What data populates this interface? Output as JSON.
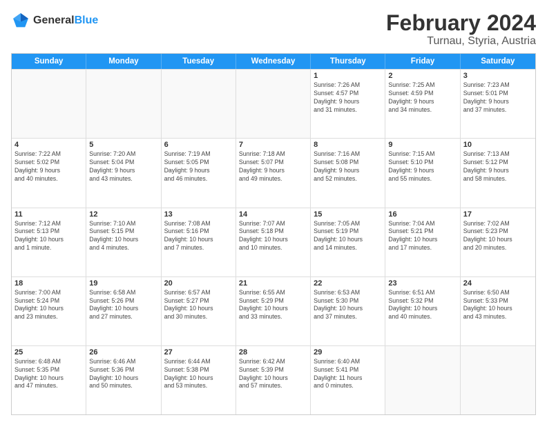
{
  "header": {
    "logo_general": "General",
    "logo_blue": "Blue",
    "title": "February 2024",
    "subtitle": "Turnau, Styria, Austria"
  },
  "weekdays": [
    "Sunday",
    "Monday",
    "Tuesday",
    "Wednesday",
    "Thursday",
    "Friday",
    "Saturday"
  ],
  "rows": [
    [
      {
        "day": "",
        "info": ""
      },
      {
        "day": "",
        "info": ""
      },
      {
        "day": "",
        "info": ""
      },
      {
        "day": "",
        "info": ""
      },
      {
        "day": "1",
        "info": "Sunrise: 7:26 AM\nSunset: 4:57 PM\nDaylight: 9 hours\nand 31 minutes."
      },
      {
        "day": "2",
        "info": "Sunrise: 7:25 AM\nSunset: 4:59 PM\nDaylight: 9 hours\nand 34 minutes."
      },
      {
        "day": "3",
        "info": "Sunrise: 7:23 AM\nSunset: 5:01 PM\nDaylight: 9 hours\nand 37 minutes."
      }
    ],
    [
      {
        "day": "4",
        "info": "Sunrise: 7:22 AM\nSunset: 5:02 PM\nDaylight: 9 hours\nand 40 minutes."
      },
      {
        "day": "5",
        "info": "Sunrise: 7:20 AM\nSunset: 5:04 PM\nDaylight: 9 hours\nand 43 minutes."
      },
      {
        "day": "6",
        "info": "Sunrise: 7:19 AM\nSunset: 5:05 PM\nDaylight: 9 hours\nand 46 minutes."
      },
      {
        "day": "7",
        "info": "Sunrise: 7:18 AM\nSunset: 5:07 PM\nDaylight: 9 hours\nand 49 minutes."
      },
      {
        "day": "8",
        "info": "Sunrise: 7:16 AM\nSunset: 5:08 PM\nDaylight: 9 hours\nand 52 minutes."
      },
      {
        "day": "9",
        "info": "Sunrise: 7:15 AM\nSunset: 5:10 PM\nDaylight: 9 hours\nand 55 minutes."
      },
      {
        "day": "10",
        "info": "Sunrise: 7:13 AM\nSunset: 5:12 PM\nDaylight: 9 hours\nand 58 minutes."
      }
    ],
    [
      {
        "day": "11",
        "info": "Sunrise: 7:12 AM\nSunset: 5:13 PM\nDaylight: 10 hours\nand 1 minute."
      },
      {
        "day": "12",
        "info": "Sunrise: 7:10 AM\nSunset: 5:15 PM\nDaylight: 10 hours\nand 4 minutes."
      },
      {
        "day": "13",
        "info": "Sunrise: 7:08 AM\nSunset: 5:16 PM\nDaylight: 10 hours\nand 7 minutes."
      },
      {
        "day": "14",
        "info": "Sunrise: 7:07 AM\nSunset: 5:18 PM\nDaylight: 10 hours\nand 10 minutes."
      },
      {
        "day": "15",
        "info": "Sunrise: 7:05 AM\nSunset: 5:19 PM\nDaylight: 10 hours\nand 14 minutes."
      },
      {
        "day": "16",
        "info": "Sunrise: 7:04 AM\nSunset: 5:21 PM\nDaylight: 10 hours\nand 17 minutes."
      },
      {
        "day": "17",
        "info": "Sunrise: 7:02 AM\nSunset: 5:23 PM\nDaylight: 10 hours\nand 20 minutes."
      }
    ],
    [
      {
        "day": "18",
        "info": "Sunrise: 7:00 AM\nSunset: 5:24 PM\nDaylight: 10 hours\nand 23 minutes."
      },
      {
        "day": "19",
        "info": "Sunrise: 6:58 AM\nSunset: 5:26 PM\nDaylight: 10 hours\nand 27 minutes."
      },
      {
        "day": "20",
        "info": "Sunrise: 6:57 AM\nSunset: 5:27 PM\nDaylight: 10 hours\nand 30 minutes."
      },
      {
        "day": "21",
        "info": "Sunrise: 6:55 AM\nSunset: 5:29 PM\nDaylight: 10 hours\nand 33 minutes."
      },
      {
        "day": "22",
        "info": "Sunrise: 6:53 AM\nSunset: 5:30 PM\nDaylight: 10 hours\nand 37 minutes."
      },
      {
        "day": "23",
        "info": "Sunrise: 6:51 AM\nSunset: 5:32 PM\nDaylight: 10 hours\nand 40 minutes."
      },
      {
        "day": "24",
        "info": "Sunrise: 6:50 AM\nSunset: 5:33 PM\nDaylight: 10 hours\nand 43 minutes."
      }
    ],
    [
      {
        "day": "25",
        "info": "Sunrise: 6:48 AM\nSunset: 5:35 PM\nDaylight: 10 hours\nand 47 minutes."
      },
      {
        "day": "26",
        "info": "Sunrise: 6:46 AM\nSunset: 5:36 PM\nDaylight: 10 hours\nand 50 minutes."
      },
      {
        "day": "27",
        "info": "Sunrise: 6:44 AM\nSunset: 5:38 PM\nDaylight: 10 hours\nand 53 minutes."
      },
      {
        "day": "28",
        "info": "Sunrise: 6:42 AM\nSunset: 5:39 PM\nDaylight: 10 hours\nand 57 minutes."
      },
      {
        "day": "29",
        "info": "Sunrise: 6:40 AM\nSunset: 5:41 PM\nDaylight: 11 hours\nand 0 minutes."
      },
      {
        "day": "",
        "info": ""
      },
      {
        "day": "",
        "info": ""
      }
    ]
  ]
}
